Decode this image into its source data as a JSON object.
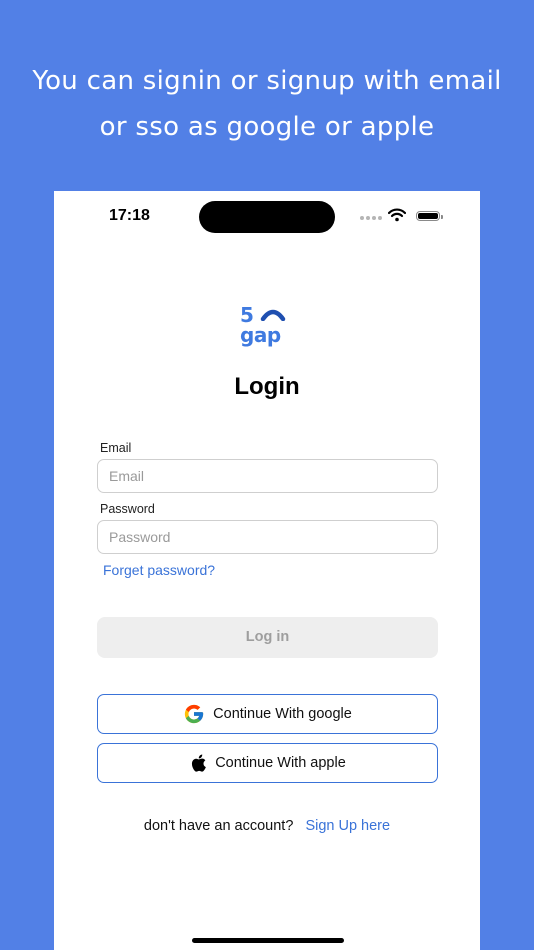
{
  "promo": {
    "line1": "You can signin or signup with email",
    "line2": "or sso as google or apple"
  },
  "status_bar": {
    "time": "17:18"
  },
  "logo": {
    "top": "5",
    "bottom": "gap"
  },
  "screen": {
    "title": "Login",
    "email_label": "Email",
    "email_placeholder": "Email",
    "email_value": "",
    "password_label": "Password",
    "password_placeholder": "Password",
    "password_value": "",
    "forget_password": "Forget password?",
    "login_button": "Log in",
    "google_button": "Continue With google",
    "apple_button": "Continue With apple",
    "signup_prompt": "don't have an account?",
    "signup_link": "Sign Up here"
  },
  "colors": {
    "background": "#5280e6",
    "accent": "#3a73d8",
    "disabled_button": "#eeeeee"
  }
}
